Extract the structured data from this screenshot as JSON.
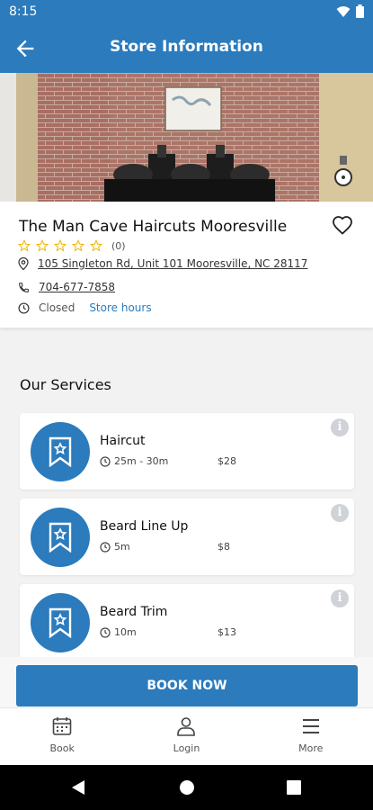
{
  "status_bar": {
    "time": "8:15"
  },
  "header": {
    "title": "Store Information"
  },
  "store": {
    "name": "The Man Cave Haircuts Mooresville",
    "rating_count": "(0)",
    "address": "105 Singleton Rd, Unit 101 Mooresville, NC 28117",
    "phone": "704-677-7858",
    "status": "Closed",
    "hours_link": "Store hours"
  },
  "services_section": {
    "title": "Our Services",
    "items": [
      {
        "name": "Haircut",
        "duration": "25m - 30m",
        "price": "$28"
      },
      {
        "name": "Beard Line Up",
        "duration": "5m",
        "price": "$8"
      },
      {
        "name": "Beard Trim",
        "duration": "10m",
        "price": "$13"
      }
    ]
  },
  "book_button": {
    "label": "BOOK NOW"
  },
  "bottom_nav": [
    {
      "label": "Book",
      "icon": "calendar-icon"
    },
    {
      "label": "Login",
      "icon": "user-icon"
    },
    {
      "label": "More",
      "icon": "menu-icon"
    }
  ],
  "colors": {
    "primary": "#2b7bbd",
    "star": "#f2b705"
  }
}
